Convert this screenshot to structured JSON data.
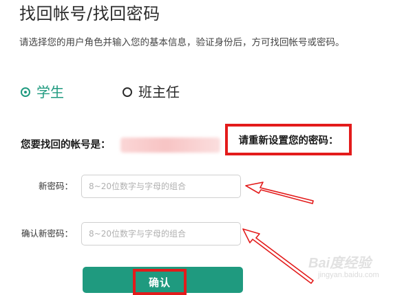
{
  "header": {
    "title": "找回帐号/找回密码",
    "description": "请选择您的用户角色并输入您的基本信息，验证身份后，方可找回帐号或密码。"
  },
  "roles": [
    {
      "label": "学生",
      "selected": true
    },
    {
      "label": "班主任",
      "selected": false
    }
  ],
  "account": {
    "label": "您要找回的帐号是：",
    "reset_prompt": "请重新设置您的密码："
  },
  "form": {
    "new_password_label": "新密码：",
    "new_password_placeholder": "8~20位数字与字母的组合",
    "confirm_password_label": "确认新密码：",
    "confirm_password_placeholder": "8~20位数字与字母的组合",
    "submit_label": "确认"
  },
  "watermark": {
    "brand": "Bai度经验",
    "url": "jingyan.baidu.com"
  },
  "colors": {
    "accent": "#1f9a7f",
    "highlight": "#e31b1b"
  }
}
